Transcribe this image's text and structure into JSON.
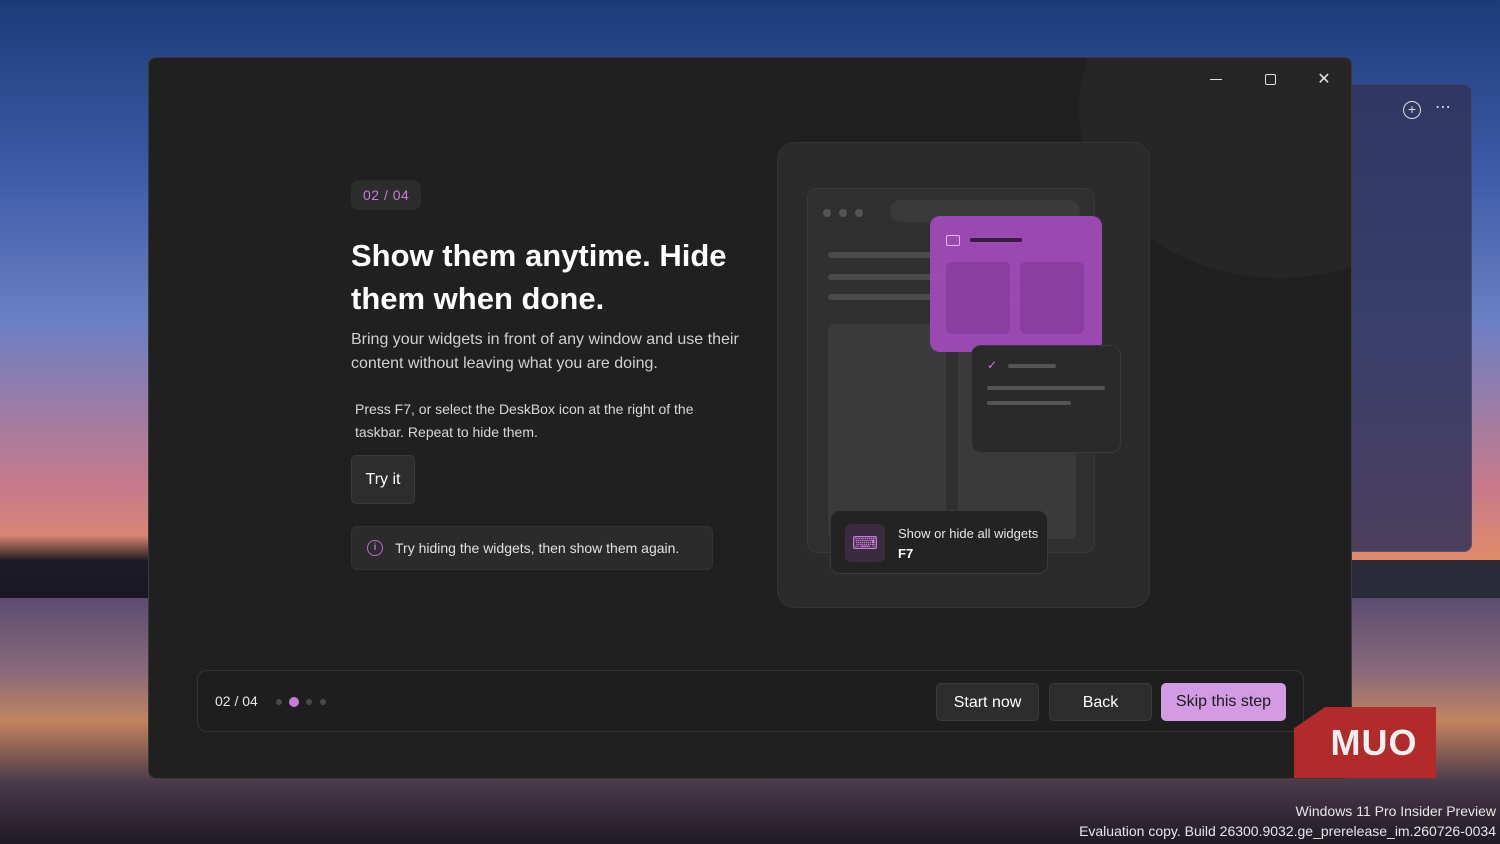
{
  "window": {
    "controls": {
      "minimize": "minimize-icon",
      "maximize": "maximize-icon",
      "close": "close-icon"
    }
  },
  "step": {
    "badge": "02  /  04"
  },
  "content": {
    "headline": "Show them anytime. Hide them when done.",
    "description": "Bring your widgets in front of any window and use their content without leaving what you are doing.",
    "hint": "Press F7, or select the DeskBox icon at the right of the taskbar. Repeat to hide them.",
    "try_label": "Try it",
    "info_text": "Try hiding the widgets, then show them again."
  },
  "illustration": {
    "shortcut_label": "Show or hide all widgets",
    "shortcut_key": "F7"
  },
  "footer": {
    "counter": "02 / 04",
    "total_steps": 4,
    "current_step": 2,
    "start_label": "Start now",
    "back_label": "Back",
    "skip_label": "Skip this step"
  },
  "background_panel": {
    "icons": [
      "add-icon",
      "more-icon"
    ]
  },
  "logo": {
    "text": "MUO"
  },
  "watermark": {
    "line1": "Windows 11 Pro Insider Preview",
    "line2": "Evaluation copy. Build 26300.9032.ge_prerelease_im.260726-0034"
  },
  "colors": {
    "accent": "#c77dd6",
    "button_primary": "#d39be3",
    "window_bg": "#202020"
  }
}
